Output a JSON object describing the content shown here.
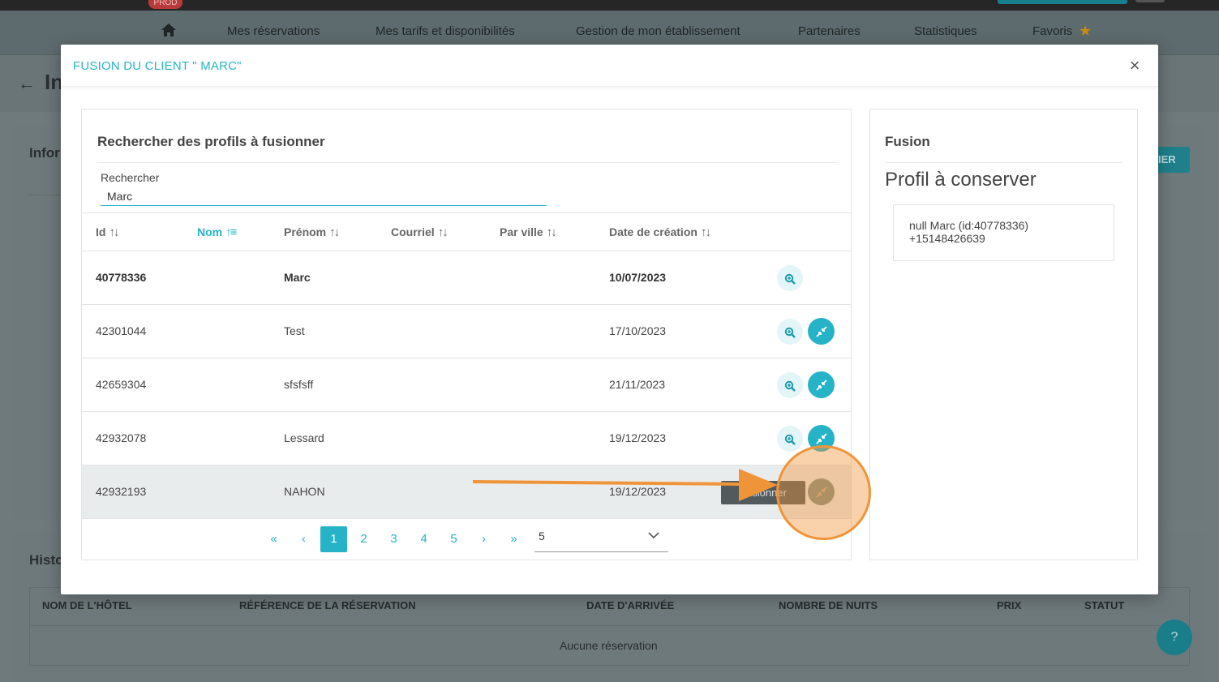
{
  "topbar": {
    "env_badge": "PROD"
  },
  "nav": {
    "items": [
      {
        "label": "Mes réservations"
      },
      {
        "label": "Mes tarifs et disponibilités"
      },
      {
        "label": "Gestion de mon établissement"
      },
      {
        "label": "Partenaires"
      },
      {
        "label": "Statistiques"
      },
      {
        "label": "Favoris"
      }
    ]
  },
  "background": {
    "page_title": "In",
    "info_title": "Infor",
    "action_button": "IER",
    "history_title": "Histo",
    "history_columns": [
      "NOM DE L'HÔTEL",
      "RÉFÉRENCE DE LA RÉSERVATION",
      "DATE D'ARRIVÉE",
      "NOMBRE DE NUITS",
      "PRIX",
      "STATUT"
    ],
    "history_empty": "Aucune réservation",
    "help_label": "?"
  },
  "modal": {
    "title": "FUSION DU CLIENT \" MARC\"",
    "close_label": "×",
    "search_section": {
      "title": "Rechercher des profils à fusionner",
      "search_label": "Rechercher",
      "search_value": "Marc"
    },
    "table": {
      "columns": [
        {
          "label": "Id",
          "sorted": false
        },
        {
          "label": "Nom",
          "sorted": true
        },
        {
          "label": "Prénom",
          "sorted": false
        },
        {
          "label": "Courriel",
          "sorted": false
        },
        {
          "label": "Par ville",
          "sorted": false
        },
        {
          "label": "Date de création",
          "sorted": false
        }
      ],
      "rows": [
        {
          "id": "40778336",
          "nom": "",
          "prenom": "Marc",
          "courriel": "",
          "ville": "",
          "date": "10/07/2023"
        },
        {
          "id": "42301044",
          "nom": "",
          "prenom": "Test",
          "courriel": "",
          "ville": "",
          "date": "17/10/2023"
        },
        {
          "id": "42659304",
          "nom": "",
          "prenom": "sfsfsff",
          "courriel": "",
          "ville": "",
          "date": "21/11/2023"
        },
        {
          "id": "42932078",
          "nom": "",
          "prenom": "Lessard",
          "courriel": "",
          "ville": "",
          "date": "19/12/2023"
        },
        {
          "id": "42932193",
          "nom": "",
          "prenom": "NAHON",
          "courriel": "",
          "ville": "",
          "date": "19/12/2023"
        }
      ],
      "tooltip": "Fusionner"
    },
    "pagination": {
      "first": "«",
      "prev": "‹",
      "pages": [
        "1",
        "2",
        "3",
        "4",
        "5"
      ],
      "current": "1",
      "next": "›",
      "last": "»",
      "per_page": "5"
    },
    "fusion": {
      "title": "Fusion",
      "keep_title": "Profil à conserver",
      "profile_line1": "null Marc (id:40778336)",
      "profile_line2": "+15148426639"
    }
  },
  "colors": {
    "accent": "#26b3c7",
    "annotation": "#f0943a"
  },
  "icons": {
    "home": "home-icon",
    "star": "star-icon",
    "zoom": "zoom-in-icon",
    "merge": "compress-arrows-icon",
    "close": "close-icon",
    "sort": "sort-icon",
    "chevron": "chevron-down-icon"
  }
}
